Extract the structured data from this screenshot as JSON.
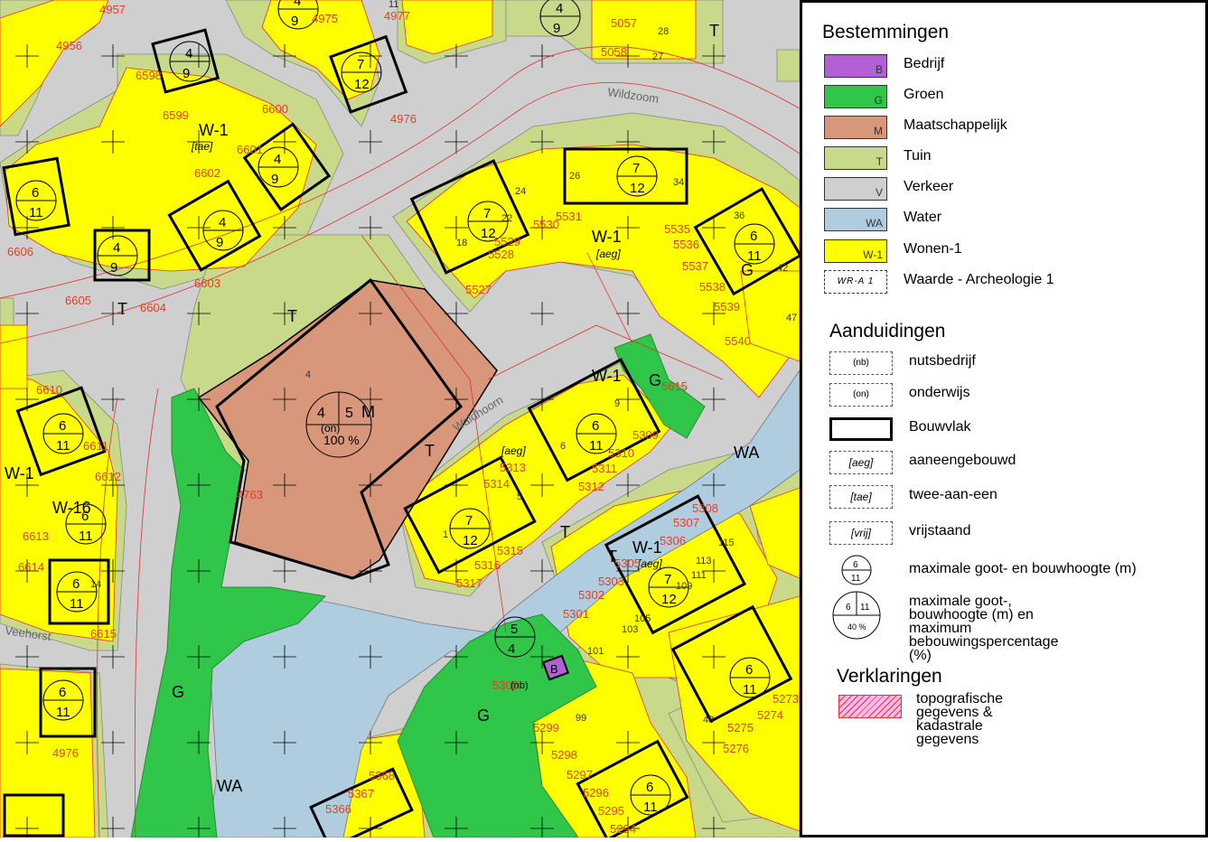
{
  "colors": {
    "bedrijf": "#b35fd6",
    "groen": "#2fc64a",
    "maatschappelijk": "#d8967a",
    "tuin": "#c8d98a",
    "verkeer": "#cfcfcf",
    "water": "#b0cde0",
    "wonen": "#ffff00",
    "red_line": "#e03030",
    "text_red": "#e04020"
  },
  "legend": {
    "bestemmingen_title": "Bestemmingen",
    "bestemmingen": [
      {
        "code": "B",
        "label": "Bedrijf"
      },
      {
        "code": "G",
        "label": "Groen"
      },
      {
        "code": "M",
        "label": "Maatschappelijk"
      },
      {
        "code": "T",
        "label": "Tuin"
      },
      {
        "code": "V",
        "label": "Verkeer"
      },
      {
        "code": "WA",
        "label": "Water"
      },
      {
        "code": "W-1",
        "label": "Wonen-1"
      },
      {
        "code": "WR-A 1",
        "label": "Waarde - Archeologie 1"
      }
    ],
    "aanduidingen_title": "Aanduidingen",
    "aanduidingen": [
      {
        "symbol": "(nb)",
        "label": "nutsbedrijf"
      },
      {
        "symbol": "(on)",
        "label": "onderwijs"
      },
      {
        "symbol": "",
        "label": "Bouwvlak"
      },
      {
        "symbol": "[aeg]",
        "label": "aaneengebouwd"
      },
      {
        "symbol": "[tae]",
        "label": "twee-aan-een"
      },
      {
        "symbol": "[vrij]",
        "label": "vrijstaand"
      }
    ],
    "height_symbol": {
      "top": "6",
      "bottom": "11",
      "label": "maximale goot- en bouwhoogte (m)"
    },
    "height_pct_symbol": {
      "left": "6",
      "right": "11",
      "pct": "40 %",
      "label_line1": "maximale goot-, bouwhoogte (m) en",
      "label_line2": "maximum bebouwingspercentage (%)"
    },
    "verklaringen_title": "Verklaringen",
    "verklaring_line1": "topografische gegevens &",
    "verklaring_line2": "kadastrale gegevens"
  },
  "map": {
    "street_names": [
      "Wildzoom",
      "Waldhoorn",
      "Veehorst"
    ],
    "zone_labels": [
      {
        "text": "W-1"
      },
      {
        "text": "[tae]"
      },
      {
        "text": "W-1"
      },
      {
        "text": "[aeg]"
      },
      {
        "text": "W-1"
      },
      {
        "text": "[aeg]"
      },
      {
        "text": "W-1"
      },
      {
        "text": "[aeg]"
      },
      {
        "text": "W-1"
      },
      {
        "text": "W-16"
      },
      {
        "text": "T"
      },
      {
        "text": "T"
      },
      {
        "text": "T"
      },
      {
        "text": "T"
      },
      {
        "text": "T"
      },
      {
        "text": "T"
      },
      {
        "text": "G"
      },
      {
        "text": "G"
      },
      {
        "text": "G"
      },
      {
        "text": "G"
      },
      {
        "text": "WA"
      },
      {
        "text": "WA"
      },
      {
        "text": "M"
      },
      {
        "text": "B"
      }
    ],
    "parcel_numbers": [
      "4957",
      "4975",
      "4977",
      "5057",
      "5058",
      "4956",
      "6598",
      "6599",
      "6600",
      "6601",
      "6602",
      "4976",
      "6603",
      "6604",
      "6605",
      "6606",
      "5527",
      "5528",
      "5529",
      "5530",
      "5531",
      "5535",
      "5536",
      "5537",
      "5538",
      "5539",
      "5540",
      "6610",
      "6611",
      "6612",
      "6613",
      "6614",
      "6615",
      "5313",
      "5314",
      "5315",
      "5316",
      "5317",
      "5309",
      "5310",
      "5311",
      "5312",
      "5307",
      "5306",
      "5305",
      "5303",
      "5302",
      "5301",
      "5299",
      "5298",
      "5297",
      "5296",
      "5295",
      "5294",
      "5275",
      "5274",
      "5276",
      "5273",
      "4763",
      "5615",
      "4976",
      "5308",
      "5368",
      "5367",
      "5366",
      "5300"
    ],
    "height_symbols": [
      {
        "t": "4",
        "b": "9"
      },
      {
        "t": "4",
        "b": "9"
      },
      {
        "t": "4",
        "b": "9"
      },
      {
        "t": "4",
        "b": "9"
      },
      {
        "t": "4",
        "b": "9"
      },
      {
        "t": "4",
        "b": "9"
      },
      {
        "t": "6",
        "b": "11"
      },
      {
        "t": "7",
        "b": "12"
      },
      {
        "t": "7",
        "b": "12"
      },
      {
        "t": "7",
        "b": "12"
      },
      {
        "t": "6",
        "b": "11"
      },
      {
        "t": "6",
        "b": "11"
      },
      {
        "t": "7",
        "b": "12"
      },
      {
        "t": "7",
        "b": "12"
      },
      {
        "t": "6",
        "b": "11"
      },
      {
        "t": "6",
        "b": "11"
      },
      {
        "t": "6",
        "b": "11"
      },
      {
        "t": "6",
        "b": "11"
      },
      {
        "t": "5",
        "b": "4"
      },
      {
        "t": "6",
        "b": "11"
      },
      {
        "t": "6",
        "b": "11"
      }
    ],
    "school": {
      "left": "4",
      "right": "5",
      "code": "(on)",
      "pct": "100 %"
    },
    "nb_code": "(nb)",
    "house_numbers": [
      "26",
      "34",
      "36",
      "42",
      "47",
      "18",
      "22",
      "24",
      "9",
      "6",
      "5",
      "1",
      "115",
      "113",
      "111",
      "109",
      "105",
      "103",
      "101",
      "99",
      "48",
      "28",
      "27",
      "11",
      "14",
      "4"
    ]
  }
}
